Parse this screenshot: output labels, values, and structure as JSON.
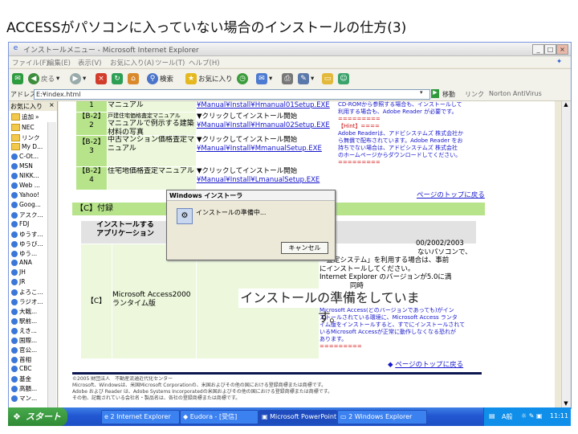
{
  "slide": {
    "title": "ACCESSがパソコンに入っていない場合のインストールの仕方(3)"
  },
  "window": {
    "title": "インストールメニュー - Microsoft Internet Explorer",
    "menu": [
      "ファイル(F)",
      "編集(E)",
      "表示(V)",
      "お気に入り(A)",
      "ツール(T)",
      "ヘルプ(H)"
    ],
    "toolbar": {
      "back": "戻る",
      "search": "検索",
      "favorites": "お気に入り"
    },
    "address_label": "アドレス(D)",
    "address_value": "E:¥index.html",
    "go_label": "移動",
    "links_label": "リンク",
    "norton": "Norton AntiVirus"
  },
  "favorites": {
    "header": "お気に入り",
    "add_label": "追加",
    "items": [
      "NEC",
      "リンク",
      "My D...",
      "C-Ot...",
      "MSN",
      "NIKK...",
      "Web ...",
      "Yahoo!",
      "Goog...",
      "アスク...",
      "FDJ",
      "ゆうす...",
      "ゆうび...",
      "ゆう...",
      "ANA",
      "JH",
      "JR",
      "よろこ...",
      "ラジオ...",
      "大戦...",
      "駅前...",
      "えき...",
      "国際...",
      "官公...",
      "首相",
      "CBC",
      "基金",
      "高額...",
      "マン..."
    ]
  },
  "table_top": {
    "rows": [
      {
        "code": "1",
        "name": "マニュアル",
        "link": "¥Manual¥Install¥Hmanual01Setup.EXE",
        "action": ""
      },
      {
        "code": "【B-2】2",
        "small": "戸建住宅価格査定マニュアル",
        "name": "マニュアルで例示する建築材料の写真",
        "action": "▼クリックしてインストール開始",
        "link": "¥Manual¥Install¥Hmanual02Setup.EXE"
      },
      {
        "code": "【B-2】3",
        "name": "中古マンション価格査定マニュアル",
        "action": "▼クリックしてインストール開始",
        "link": "¥Manual¥Install¥MmanualSetup.EXE"
      },
      {
        "code": "【B-2】4",
        "name": "住宅地価格査定マニュアル",
        "action": "▼クリックしてインストール開始",
        "link": "¥Manual¥Install¥LmanualSetup.EXE"
      }
    ],
    "note_lines": [
      "CD-ROMから参照する場合も、インストールして",
      "利用する場合も、Adobe Reader が必要です。",
      "=========",
      "【Hint】====",
      "Adobe Readerは、アドビシステムズ 株式会社か",
      "ら無償で配布されています。Adobe Reader をお",
      "持ちでない場合は、アドビシステムズ 株式会社",
      "のホームページからダウンロードしてください。",
      "========="
    ],
    "page_top_link": "ページのトップに戻る"
  },
  "section_c": {
    "heading": "【C】付録",
    "col_app_line1": "インストールする",
    "col_app_line2": "アプリケーション",
    "row_code": "【C】",
    "row_name_line1": "Microsoft Access2000",
    "row_name_line2": "ランタイム版",
    "desc_lines": [
      "00/2002/2003",
      "ないパソコンで、",
      "「査定システム」を利用する場合は、事前",
      "にインストールしてください。",
      "Internet Explorer のバージョンが5.0に満",
      "              同時"
    ],
    "note_lines": [
      "Microsoft Access(どのバージョンであっても)がイン",
      "ストールされている環境に、Microsoft Access ランタ",
      "イム版をインストールすると、すでにインストールされて",
      "いるMicrosoft Accessが正常に動作しなくなる恐れが",
      "あります。",
      "========="
    ],
    "page_top_link": "ページのトップに戻る"
  },
  "footer_lines": [
    "©2005 財団法人　不動産流通近代化センター",
    "Microsoft、Windowsは、米国Microsoft Corporationの、米国およびその他の国における登録商標または商標です。",
    "Adobe および Reader は、Adobe Systems Incorporatedの米国およびその他の国における登録商標または商標です。",
    "その他、記載されている会社名・製品名は、各社の登録商標または商標です。"
  ],
  "dialog": {
    "title": "Windows インストーラ",
    "message": "インストールの準備中...",
    "cancel": "キャンセル"
  },
  "caption": "インストールの準備をしています。",
  "taskbar": {
    "start": "スタート",
    "tasks": [
      "2 Internet Explorer",
      "Eudora - [受信]",
      "Microsoft PowerPoint...",
      "2 Windows Explorer"
    ],
    "ime": "A般",
    "clock": "11:11"
  }
}
